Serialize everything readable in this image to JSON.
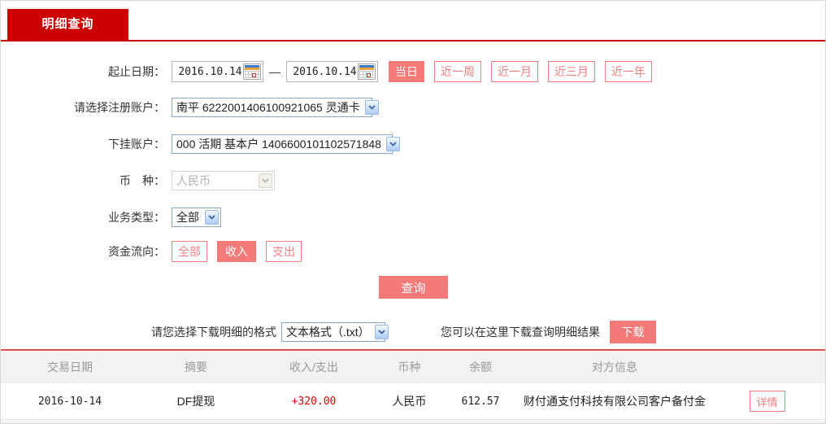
{
  "tab": {
    "label": "明细查询"
  },
  "form": {
    "date_label": "起止日期：",
    "date_from": "2016.10.14",
    "date_to": "2016.10.14",
    "date_separator": "—",
    "quick_ranges": {
      "today": "当日",
      "week": "近一周",
      "month": "近一月",
      "quarter": "近三月",
      "year": "近一年"
    },
    "registered_account": {
      "label": "请选择注册账户：",
      "value": "南平 6222001406100921065 灵通卡"
    },
    "sub_account": {
      "label": "下挂账户：",
      "value": "000 活期 基本户 1406600101102571848"
    },
    "currency": {
      "label": "币　种：",
      "value": "人民币"
    },
    "business_type": {
      "label": "业务类型：",
      "value": "全部"
    },
    "fund_flow": {
      "label": "资金流向：",
      "all": "全部",
      "income": "收入",
      "expense": "支出"
    },
    "query_button": "查询"
  },
  "download": {
    "format_label": "请您选择下载明细的格式",
    "format_value": "文本格式（.txt）",
    "hint": "您可以在这里下载查询明细结果",
    "button": "下载"
  },
  "table": {
    "headers": [
      "交易日期",
      "摘要",
      "收入/支出",
      "币种",
      "余额",
      "对方信息"
    ],
    "rows": [
      {
        "date": "2016-10-14",
        "summary": "DF提现",
        "amount": "+320.00",
        "currency": "人民币",
        "balance": "612.57",
        "counterparty": "财付通支付科技有限公司客户备付金",
        "detail_button": "详情"
      }
    ]
  },
  "colors": {
    "brand_red": "#cc0000",
    "pink": "#f47a7a",
    "amount_red": "#e60000"
  }
}
